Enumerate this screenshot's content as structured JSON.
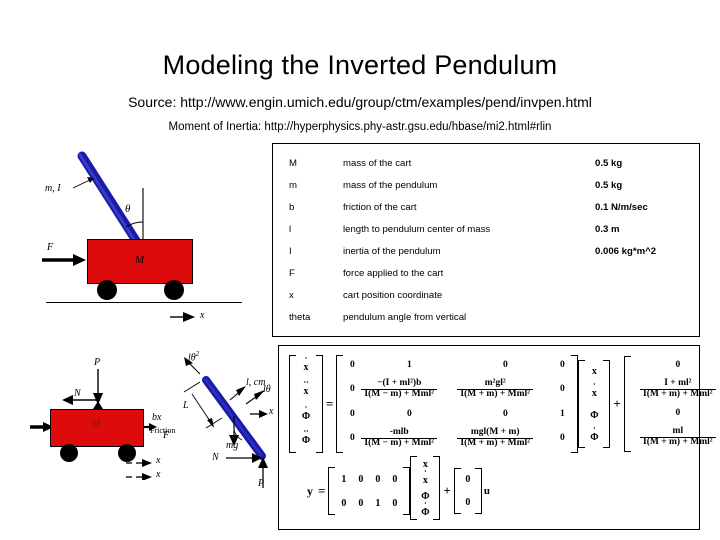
{
  "slide": {
    "title": "Modeling the Inverted Pendulum",
    "source": "Source: http://www.engin.umich.edu/group/ctm/examples/pend/invpen.html",
    "inertia_ref": "Moment of Inertia: http://hyperphysics.phy-astr.gsu.edu/hbase/mi2.html#rlin"
  },
  "colors": {
    "cart": "#dd0b0b",
    "pendulum": "#1a1aa8",
    "outline": "#000000",
    "background": "#ffffff"
  },
  "parameters": {
    "rows": [
      {
        "symbol": "M",
        "description": "mass of the cart",
        "value": "0.5 kg"
      },
      {
        "symbol": "m",
        "description": "mass of the pendulum",
        "value": "0.5 kg"
      },
      {
        "symbol": "b",
        "description": "friction of the cart",
        "value": "0.1 N/m/sec"
      },
      {
        "symbol": "l",
        "description": "length to pendulum center of mass",
        "value": "0.3 m"
      },
      {
        "symbol": "I",
        "description": "inertia of the pendulum",
        "value": "0.006 kg*m^2"
      },
      {
        "symbol": "F",
        "description": "force applied to the cart",
        "value": ""
      },
      {
        "symbol": "x",
        "description": "cart position coordinate",
        "value": ""
      },
      {
        "symbol": "theta",
        "description": "pendulum angle from vertical",
        "value": ""
      }
    ]
  },
  "diagram_top": {
    "name": "inverted-pendulum-schematic",
    "cart_label": "M",
    "pendulum_label": "m, I",
    "angle_label": "θ",
    "force_label": "F",
    "axis_label": "x"
  },
  "diagram_bottom_cart": {
    "name": "cart-free-body-diagram",
    "cart_label": "M",
    "normal_label": "N",
    "vertical_label": "P",
    "force_label": "F",
    "velocity_label": "x",
    "accel_label": "x"
  },
  "diagram_bottom_pendulum": {
    "name": "pendulum-free-body-diagram",
    "centripetal_label": "lθ",
    "centripetal_exp": "2",
    "cm_label": "l, cm",
    "tangential_label": "lθ",
    "length_label": "L",
    "friction_label": "b",
    "friction_sub": "x",
    "friction_caption": "Friction",
    "weight_label": "mg",
    "normal_label": "N",
    "vertical_label": "P",
    "accel_label": "x",
    "angle_label": "θ"
  },
  "state_equation": {
    "lhs_vector": [
      "x",
      "x",
      "Φ",
      "Φ"
    ],
    "lhs_dots": [
      1,
      2,
      1,
      2
    ],
    "equals": "=",
    "A_matrix": [
      [
        {
          "t": "plain",
          "v": "0"
        },
        {
          "t": "plain",
          "v": "1"
        },
        {
          "t": "plain",
          "v": "0"
        },
        {
          "t": "plain",
          "v": "0"
        }
      ],
      [
        {
          "t": "plain",
          "v": "0"
        },
        {
          "t": "frac",
          "num": "−(I + ml²)b",
          "den": "I(M − m) + Mml²"
        },
        {
          "t": "frac",
          "num": "m²gl²",
          "den": "I(M + m) + Mml²"
        },
        {
          "t": "plain",
          "v": "0"
        }
      ],
      [
        {
          "t": "plain",
          "v": "0"
        },
        {
          "t": "plain",
          "v": "0"
        },
        {
          "t": "plain",
          "v": "0"
        },
        {
          "t": "plain",
          "v": "1"
        }
      ],
      [
        {
          "t": "plain",
          "v": "0"
        },
        {
          "t": "frac",
          "num": "-mlb",
          "den": "I(M − m) + Mml²"
        },
        {
          "t": "frac",
          "num": "mgl(M + m)",
          "den": "I(M + m) + Mml²"
        },
        {
          "t": "plain",
          "v": "0"
        }
      ]
    ],
    "state_vector": [
      "x",
      "x",
      "Φ",
      "Φ"
    ],
    "state_dots": [
      0,
      1,
      0,
      1
    ],
    "plus": "+",
    "B_matrix": [
      {
        "t": "plain",
        "v": "0"
      },
      {
        "t": "frac",
        "num": "I + ml²",
        "den": "I(M + m) + Mml²"
      },
      {
        "t": "plain",
        "v": "0"
      },
      {
        "t": "frac",
        "num": "ml",
        "den": "I(M + m) + Mml²"
      }
    ],
    "input_label": "u"
  },
  "output_equation": {
    "y_label": "y",
    "equals": "=",
    "C_matrix": [
      [
        "1",
        "0",
        "0",
        "0"
      ],
      [
        "0",
        "0",
        "1",
        "0"
      ]
    ],
    "state_vector": [
      "x",
      "x",
      "Φ",
      "Φ"
    ],
    "state_dots": [
      0,
      1,
      0,
      1
    ],
    "plus": "+",
    "D_matrix": [
      "0",
      "0"
    ],
    "input_label": "u"
  }
}
